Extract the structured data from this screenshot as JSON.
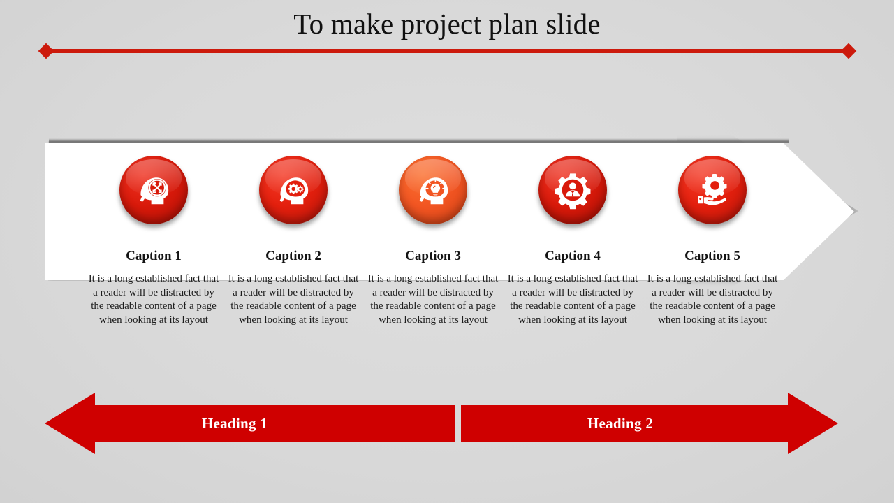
{
  "slide": {
    "title": "To make project plan slide",
    "background_color": "#d8d8d8",
    "accent_color": "#cc1a0c"
  },
  "steps": [
    {
      "icon": "head-expand-arrows-icon",
      "circle_color": "#d8190a",
      "caption_title": "Caption 1",
      "caption_body": "It is a long established fact that a reader will be distracted by the readable content of a page when looking at its layout"
    },
    {
      "icon": "head-gears-icon",
      "circle_color": "#e31f0d",
      "caption_title": "Caption 2",
      "caption_body": "It is a long established fact that a reader will be distracted by the readable content of a page when looking at its layout"
    },
    {
      "icon": "head-lightbulb-icon",
      "circle_color": "#f25522",
      "caption_title": "Caption 3",
      "caption_body": "It is a long established fact that a reader will be distracted by the readable content of a page when looking at its layout"
    },
    {
      "icon": "gear-person-icon",
      "circle_color": "#d8190a",
      "caption_title": "Caption 4",
      "caption_body": "It is a long established fact that a reader will be distracted by the readable content of a page when looking at its layout"
    },
    {
      "icon": "hand-holding-gear-icon",
      "circle_color": "#e31f0d",
      "caption_title": "Caption 5",
      "caption_body": "It is a long established fact that a reader will be distracted by the readable content of a page when looking at its layout"
    }
  ],
  "headings": {
    "left": {
      "label": "Heading 1",
      "direction": "left",
      "color": "#cf0000"
    },
    "right": {
      "label": "Heading 2",
      "direction": "right",
      "color": "#cf0000"
    }
  }
}
